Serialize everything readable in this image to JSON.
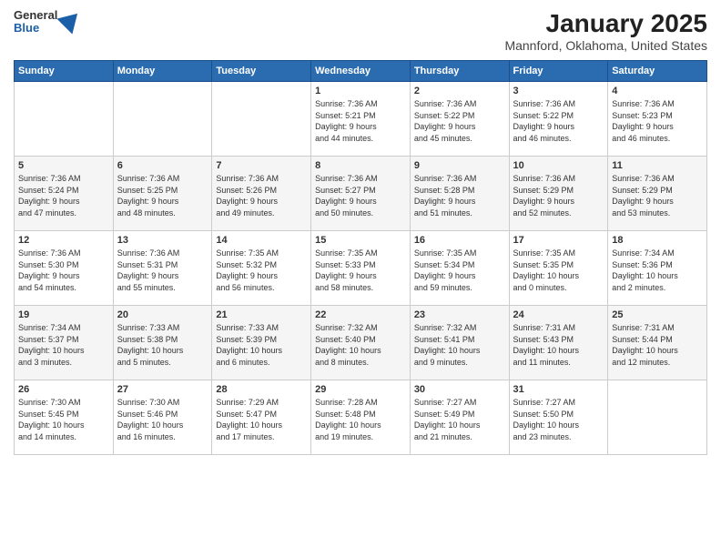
{
  "header": {
    "logo_general": "General",
    "logo_blue": "Blue",
    "month_title": "January 2025",
    "location": "Mannford, Oklahoma, United States"
  },
  "weekdays": [
    "Sunday",
    "Monday",
    "Tuesday",
    "Wednesday",
    "Thursday",
    "Friday",
    "Saturday"
  ],
  "weeks": [
    [
      {
        "day": "",
        "text": ""
      },
      {
        "day": "",
        "text": ""
      },
      {
        "day": "",
        "text": ""
      },
      {
        "day": "1",
        "text": "Sunrise: 7:36 AM\nSunset: 5:21 PM\nDaylight: 9 hours\nand 44 minutes."
      },
      {
        "day": "2",
        "text": "Sunrise: 7:36 AM\nSunset: 5:22 PM\nDaylight: 9 hours\nand 45 minutes."
      },
      {
        "day": "3",
        "text": "Sunrise: 7:36 AM\nSunset: 5:22 PM\nDaylight: 9 hours\nand 46 minutes."
      },
      {
        "day": "4",
        "text": "Sunrise: 7:36 AM\nSunset: 5:23 PM\nDaylight: 9 hours\nand 46 minutes."
      }
    ],
    [
      {
        "day": "5",
        "text": "Sunrise: 7:36 AM\nSunset: 5:24 PM\nDaylight: 9 hours\nand 47 minutes."
      },
      {
        "day": "6",
        "text": "Sunrise: 7:36 AM\nSunset: 5:25 PM\nDaylight: 9 hours\nand 48 minutes."
      },
      {
        "day": "7",
        "text": "Sunrise: 7:36 AM\nSunset: 5:26 PM\nDaylight: 9 hours\nand 49 minutes."
      },
      {
        "day": "8",
        "text": "Sunrise: 7:36 AM\nSunset: 5:27 PM\nDaylight: 9 hours\nand 50 minutes."
      },
      {
        "day": "9",
        "text": "Sunrise: 7:36 AM\nSunset: 5:28 PM\nDaylight: 9 hours\nand 51 minutes."
      },
      {
        "day": "10",
        "text": "Sunrise: 7:36 AM\nSunset: 5:29 PM\nDaylight: 9 hours\nand 52 minutes."
      },
      {
        "day": "11",
        "text": "Sunrise: 7:36 AM\nSunset: 5:29 PM\nDaylight: 9 hours\nand 53 minutes."
      }
    ],
    [
      {
        "day": "12",
        "text": "Sunrise: 7:36 AM\nSunset: 5:30 PM\nDaylight: 9 hours\nand 54 minutes."
      },
      {
        "day": "13",
        "text": "Sunrise: 7:36 AM\nSunset: 5:31 PM\nDaylight: 9 hours\nand 55 minutes."
      },
      {
        "day": "14",
        "text": "Sunrise: 7:35 AM\nSunset: 5:32 PM\nDaylight: 9 hours\nand 56 minutes."
      },
      {
        "day": "15",
        "text": "Sunrise: 7:35 AM\nSunset: 5:33 PM\nDaylight: 9 hours\nand 58 minutes."
      },
      {
        "day": "16",
        "text": "Sunrise: 7:35 AM\nSunset: 5:34 PM\nDaylight: 9 hours\nand 59 minutes."
      },
      {
        "day": "17",
        "text": "Sunrise: 7:35 AM\nSunset: 5:35 PM\nDaylight: 10 hours\nand 0 minutes."
      },
      {
        "day": "18",
        "text": "Sunrise: 7:34 AM\nSunset: 5:36 PM\nDaylight: 10 hours\nand 2 minutes."
      }
    ],
    [
      {
        "day": "19",
        "text": "Sunrise: 7:34 AM\nSunset: 5:37 PM\nDaylight: 10 hours\nand 3 minutes."
      },
      {
        "day": "20",
        "text": "Sunrise: 7:33 AM\nSunset: 5:38 PM\nDaylight: 10 hours\nand 5 minutes."
      },
      {
        "day": "21",
        "text": "Sunrise: 7:33 AM\nSunset: 5:39 PM\nDaylight: 10 hours\nand 6 minutes."
      },
      {
        "day": "22",
        "text": "Sunrise: 7:32 AM\nSunset: 5:40 PM\nDaylight: 10 hours\nand 8 minutes."
      },
      {
        "day": "23",
        "text": "Sunrise: 7:32 AM\nSunset: 5:41 PM\nDaylight: 10 hours\nand 9 minutes."
      },
      {
        "day": "24",
        "text": "Sunrise: 7:31 AM\nSunset: 5:43 PM\nDaylight: 10 hours\nand 11 minutes."
      },
      {
        "day": "25",
        "text": "Sunrise: 7:31 AM\nSunset: 5:44 PM\nDaylight: 10 hours\nand 12 minutes."
      }
    ],
    [
      {
        "day": "26",
        "text": "Sunrise: 7:30 AM\nSunset: 5:45 PM\nDaylight: 10 hours\nand 14 minutes."
      },
      {
        "day": "27",
        "text": "Sunrise: 7:30 AM\nSunset: 5:46 PM\nDaylight: 10 hours\nand 16 minutes."
      },
      {
        "day": "28",
        "text": "Sunrise: 7:29 AM\nSunset: 5:47 PM\nDaylight: 10 hours\nand 17 minutes."
      },
      {
        "day": "29",
        "text": "Sunrise: 7:28 AM\nSunset: 5:48 PM\nDaylight: 10 hours\nand 19 minutes."
      },
      {
        "day": "30",
        "text": "Sunrise: 7:27 AM\nSunset: 5:49 PM\nDaylight: 10 hours\nand 21 minutes."
      },
      {
        "day": "31",
        "text": "Sunrise: 7:27 AM\nSunset: 5:50 PM\nDaylight: 10 hours\nand 23 minutes."
      },
      {
        "day": "",
        "text": ""
      }
    ]
  ]
}
